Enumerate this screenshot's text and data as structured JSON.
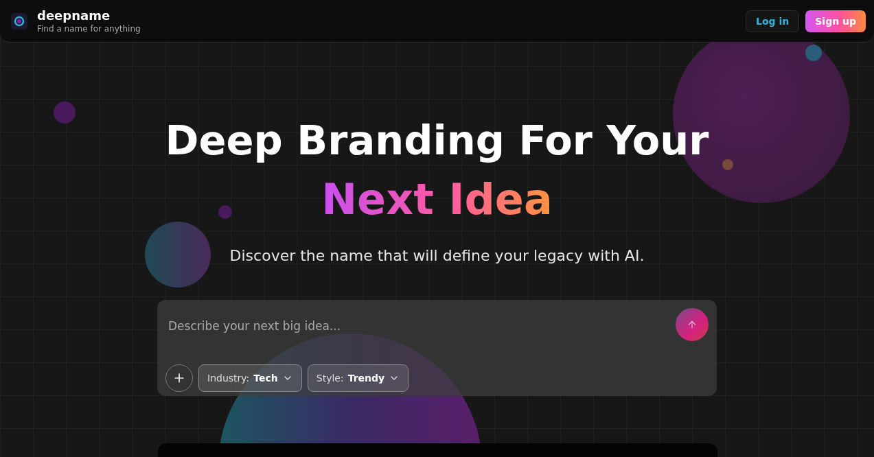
{
  "header": {
    "brand": "deepname",
    "tagline": "Find a name for anything",
    "buttons": [
      {
        "label": "Log in",
        "kind": "outline"
      },
      {
        "label": "Sign up",
        "kind": "gradient"
      }
    ]
  },
  "hero": {
    "title_line_1": "Deep Branding For Your",
    "title_line_2": "Next Idea",
    "subtitle": "Discover the name that will define your legacy with AI."
  },
  "prompt": {
    "placeholder": "Describe your next big idea...",
    "filters": [
      {
        "label": "Industry:",
        "value": "Tech"
      },
      {
        "label": "Style:",
        "value": "Trendy"
      }
    ]
  }
}
